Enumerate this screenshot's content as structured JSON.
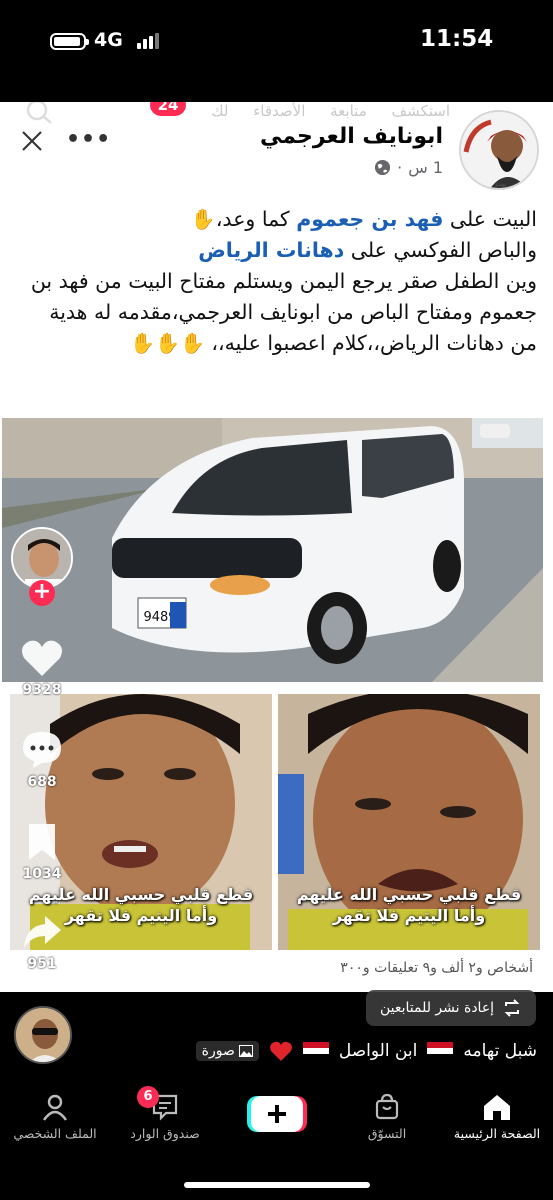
{
  "status_bar": {
    "network": "4G",
    "time": "11:54"
  },
  "ghost_header": {
    "tabs": [
      "استكشف",
      "متابعة",
      "الأصدقاء",
      "لك"
    ],
    "badge": "24"
  },
  "post": {
    "author": "ابونايف العرجمي",
    "time": "1 س",
    "separator": "·",
    "text_parts": {
      "p1a": "البيت على ",
      "p1b": "فهد بن جعموم",
      "p1c": " كما وعد،",
      "p2a": "والباص الفوكسي على ",
      "p2b": "دهانات الرياض",
      "p3": "وين الطفل صقر يرجع اليمن ويستلم مفتاح البيت من فهد بن جعموم ومفتاح الباص من ابونايف العرجمي،مقدمه له هدية من دهانات الرياض،،كلام اعصبوا عليه،،"
    },
    "hand_emoji": "✋",
    "plate_number": "9489",
    "kid_caption_line1": "قطع قلبي حسبي الله عليهم",
    "kid_caption_line2": "وأما اليتيم فلا تقهر",
    "stats_partial": "أشخاص و٢ ألف و٩ تعليقات و٣٠٠"
  },
  "rail": {
    "likes": "9328",
    "comments": "688",
    "saves": "1034",
    "shares": "951"
  },
  "overlay": {
    "repost_label": "إعادة نشر للمتابعين",
    "username": "شبل تهامه",
    "username2": "ابن الواصل",
    "photo_label": "صورة"
  },
  "nav": {
    "home": "الصفحة الرئيسية",
    "shop": "التسوّق",
    "inbox": "صندوق الوارد",
    "inbox_badge": "6",
    "profile": "الملف الشخصي"
  },
  "colors": {
    "accent": "#fe2c55",
    "link_blue": "#1a5fb4"
  }
}
